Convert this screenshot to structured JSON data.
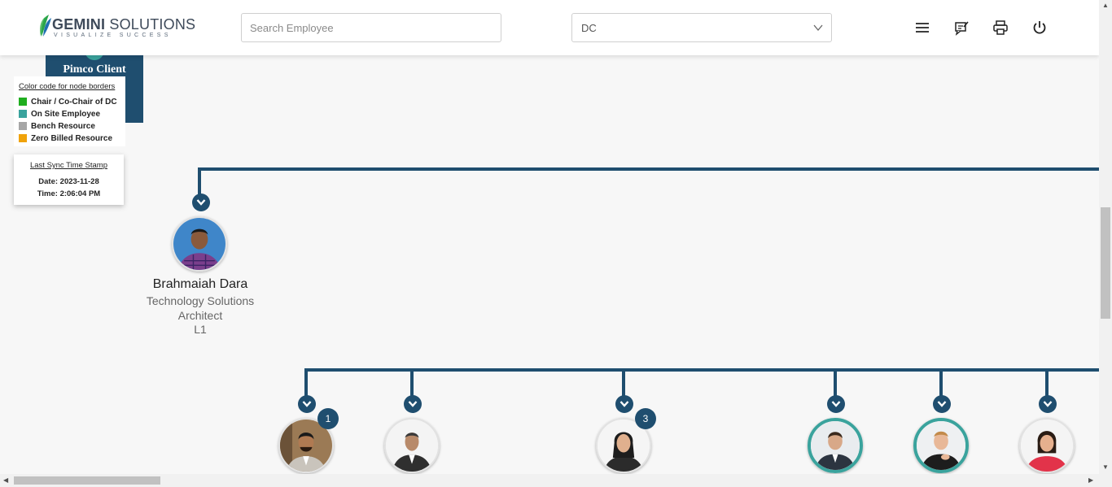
{
  "header": {
    "logo_name_bold": "GEMINI",
    "logo_name_rest": " SOLUTIONS",
    "logo_tagline": "VISUALIZE SUCCESS",
    "search_placeholder": "Search Employee",
    "dc_select_value": "DC",
    "icons": [
      "menu-icon",
      "feedback-icon",
      "print-icon",
      "power-icon"
    ]
  },
  "panel": {
    "title": "Pimco Client"
  },
  "legend": {
    "title": "Color code for node borders",
    "items": [
      {
        "label": "Chair / Co-Chair of DC",
        "color": "#1fae1f"
      },
      {
        "label": "On Site Employee",
        "color": "#3aa39d"
      },
      {
        "label": "Bench Resource",
        "color": "#a6a6a6"
      },
      {
        "label": "Zero Billed Resource",
        "color": "#f0a30a"
      }
    ]
  },
  "sync": {
    "title": "Last Sync Time Stamp",
    "date": "Date: 2023-11-28",
    "time": "Time: 2:06:04 PM"
  },
  "employee": {
    "name": "Brahmaiah Dara",
    "title": "Technology Solutions Architect",
    "level": "L1"
  },
  "reports": [
    {
      "badge": "1",
      "status": "default"
    },
    {
      "badge": "",
      "status": "default"
    },
    {
      "badge": "3",
      "status": "default"
    },
    {
      "badge": "",
      "status": "onsite"
    },
    {
      "badge": "",
      "status": "onsite"
    },
    {
      "badge": "",
      "status": "default"
    }
  ],
  "colors": {
    "accent": "#1f4e6f",
    "onsite": "#3aa39d"
  }
}
